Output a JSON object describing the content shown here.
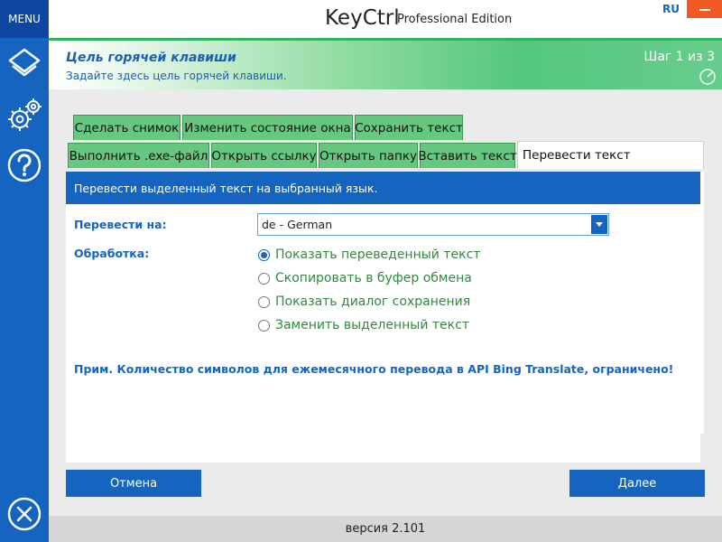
{
  "sidebar": {
    "menu_label": "MENU",
    "icons": [
      "layers-icon",
      "settings-gear-icon",
      "help-icon"
    ],
    "exit_icon": "exit-x-icon"
  },
  "header": {
    "title": "KeyCtrl",
    "edition": "Professional Edition",
    "language": "RU",
    "close_icon": "minimize-icon"
  },
  "banner": {
    "title": "Цель горячей клавиши",
    "subtitle": "Задайте здесь цель горячей клавиши.",
    "step": "Шаг 1 из 3",
    "step_icon": "progress-ring-icon"
  },
  "tabs": {
    "row1": [
      "Сделать снимок",
      "Изменить состояние окна",
      "Сохранить текст"
    ],
    "row2": [
      "Выполнить .exe-файл",
      "Открыть ссылку",
      "Открыть папку",
      "Вставить текст",
      "Перевести текст"
    ],
    "active": "Перевести текст"
  },
  "panel": {
    "description": "Перевести выделенный текст на выбранный язык.",
    "translate_label": "Перевести на:",
    "translate_value": "de - German",
    "processing_label": "Обработка:",
    "options": [
      {
        "label": "Показать переведенный текст",
        "checked": true
      },
      {
        "label": "Скопировать в буфер обмена",
        "checked": false
      },
      {
        "label": "Показать диалог сохранения",
        "checked": false
      },
      {
        "label": "Заменить выделенный текст",
        "checked": false
      }
    ],
    "note": "Прим. Количество символов для ежемесячного перевода в API Bing Translate, ограничено!"
  },
  "buttons": {
    "cancel": "Отмена",
    "next": "Далее"
  },
  "footer": {
    "version": "версия 2.101"
  },
  "colors": {
    "primary_blue": "#1565c0",
    "tab_green": "#66c77e",
    "option_green": "#2e8b3e",
    "close_orange": "#f15a24"
  }
}
